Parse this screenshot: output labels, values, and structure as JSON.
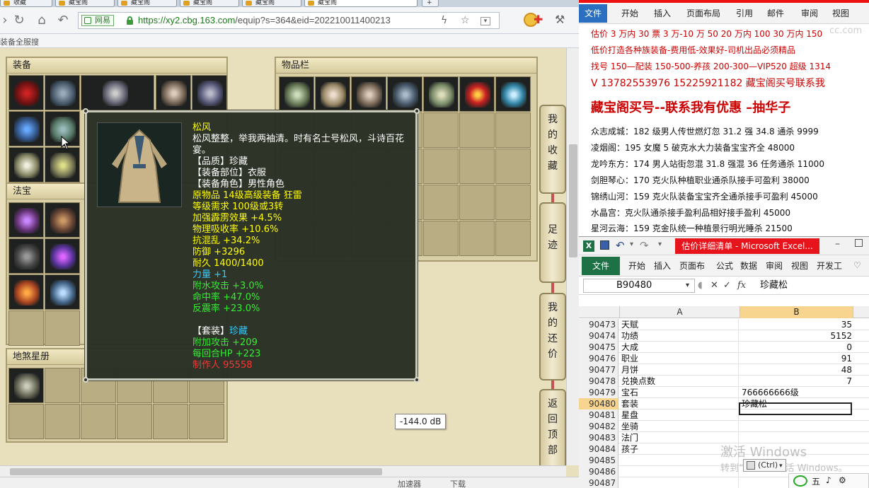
{
  "browser": {
    "tabs": [
      {
        "label": "收藏"
      },
      {
        "label": "藏宝阁"
      },
      {
        "label": "藏宝阁"
      },
      {
        "label": "藏宝阁"
      },
      {
        "label": "藏宝阁"
      },
      {
        "label": "藏宝阁"
      }
    ],
    "new_tab": "+",
    "site_badge": "网易",
    "url_main": "https://xy2.cbg.163.com",
    "url_rest": "/equip?s=364&eid=202210011400213",
    "bookmark_text": "装备全服搜",
    "status_items": [
      "加速器",
      "下载"
    ]
  },
  "game": {
    "equip_panel_title": "装备",
    "fabao_panel_title": "法宝",
    "star_panel_title": "地煞星册",
    "inventory_panel_title": "物品栏",
    "side_buttons": [
      {
        "label": "我的收藏"
      },
      {
        "label": "足迹"
      },
      {
        "label": "我的还价"
      },
      {
        "label": "返回顶部"
      }
    ],
    "volume_tooltip": "-144.0 dB",
    "item_tooltip": {
      "name": "松风",
      "desc": "松风整整，举我两袖清。时有名士号松风，斗诗百花宴。",
      "quality": "【品质】珍藏",
      "slot": "【装备部位】衣服",
      "role": "【装备角色】男性角色",
      "origin": "原物品 14级高级装备 狂雷",
      "level_req": "等级需求 100级或3转",
      "stat1": "加强霹雳效果 +4.5%",
      "stat2": "物理吸收率 +10.6%",
      "stat3": "抗混乱 +34.2%",
      "stat4": "防御 +3296",
      "durability": "耐久 1400/1400",
      "strength": "力量 +1",
      "bonus1": "附水攻击 +3.0%",
      "bonus2": "命中率 +47.0%",
      "bonus3": "反震率 +23.0%",
      "set_label": "【套装】",
      "set_name": "珍藏",
      "set1": "附加攻击 +209",
      "set2": "每回合HP +223",
      "maker": "制作人 95558"
    }
  },
  "word": {
    "tabs": [
      "文件",
      "开始",
      "插入",
      "页面布局",
      "引用",
      "邮件",
      "审阅",
      "视图"
    ],
    "watermark": "cc.com",
    "lines": [
      "估价 3 万内 30 票  3 万-10 万 50 20 万内 100 30 万内 150",
      "低价打造各种族装备-费用低-效果好-司机出品必须精品",
      "找号 150—配装 150-500-养孩 200-300—VIP520 超级 1314",
      "V 13782553976    15225921182  藏宝阁买号联系我",
      "藏宝阁买号--联系我有优惠 –抽华子",
      "众志成城：182 级男人传世燃灯忽 31.2 强 34.8 通杀 9999",
      "凌烟阁：195 女魔 5 破克水大力装备宝宝齐全 48000",
      "龙吟东方：174 男人站街忽混 31.8 强混 36 任务通杀 11000",
      "剑胆琴心：170 克火队种植职业通杀队接手可盈利 38000",
      "锦绣山河：159 克火队装备宝宝齐全通杀接手可盈利 45000",
      "水晶宫：克火队通杀接手盈利品相好接手盈利 45000",
      "星河云海：159 克金队统一种植景行明光睡杀 21500"
    ]
  },
  "excel": {
    "title": "估价详细清单 - Microsoft Excel...",
    "logo": "X",
    "tabs": [
      "文件",
      "开始",
      "插入",
      "页面布",
      "公式",
      "数据",
      "审阅",
      "视图",
      "开发工"
    ],
    "name_box": "B90480",
    "formula_value": "珍藏松",
    "fx": "fx",
    "col_a": "A",
    "col_b": "B",
    "rows": [
      {
        "n": "90473",
        "a": "天赋",
        "b": "35"
      },
      {
        "n": "90474",
        "a": "功绩",
        "b": "5152"
      },
      {
        "n": "90475",
        "a": "大成",
        "b": "0"
      },
      {
        "n": "90476",
        "a": "职业",
        "b": "91"
      },
      {
        "n": "90477",
        "a": "月饼",
        "b": "48"
      },
      {
        "n": "90478",
        "a": "兑换点数",
        "b": "7"
      },
      {
        "n": "90479",
        "a": "宝石",
        "b": "766666666级"
      },
      {
        "n": "90480",
        "a": "套装",
        "b": "珍藏松"
      },
      {
        "n": "90481",
        "a": "星盘",
        "b": ""
      },
      {
        "n": "90482",
        "a": "坐骑",
        "b": ""
      },
      {
        "n": "90483",
        "a": "法门",
        "b": ""
      },
      {
        "n": "90484",
        "a": "孩子",
        "b": ""
      },
      {
        "n": "90485",
        "a": "",
        "b": ""
      },
      {
        "n": "90486",
        "a": "",
        "b": ""
      },
      {
        "n": "90487",
        "a": "",
        "b": ""
      }
    ],
    "paste_label": "(Ctrl)",
    "watermark_line1": "激活 Windows",
    "watermark_line2": "转到“设置”以激活 Windows。"
  }
}
